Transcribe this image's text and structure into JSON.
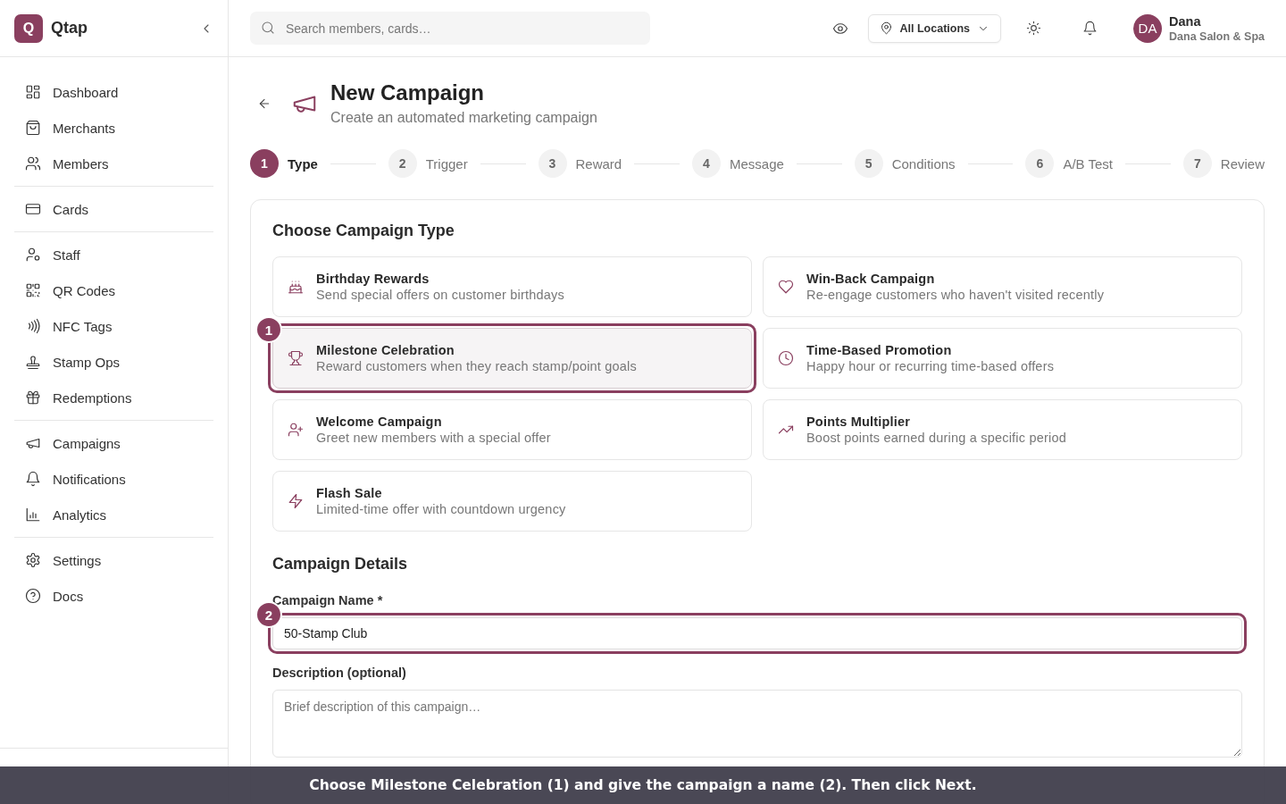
{
  "brand": {
    "logo": "Q",
    "name": "Qtap"
  },
  "nav_groups": [
    [
      "Dashboard",
      "Merchants",
      "Members"
    ],
    [
      "Cards"
    ],
    [
      "Staff",
      "QR Codes",
      "NFC Tags",
      "Stamp Ops",
      "Redemptions"
    ],
    [
      "Campaigns",
      "Notifications",
      "Analytics"
    ],
    [
      "Settings",
      "Docs"
    ]
  ],
  "search": {
    "placeholder": "Search members, cards…"
  },
  "location": "All Locations",
  "user": {
    "initials": "DA",
    "name": "Dana",
    "business": "Dana Salon & Spa"
  },
  "page": {
    "title": "New Campaign",
    "subtitle": "Create an automated marketing campaign"
  },
  "steps": [
    {
      "number": "1",
      "label": "Type",
      "selected": true
    },
    {
      "number": "2",
      "label": "Trigger",
      "selected": false
    },
    {
      "number": "3",
      "label": "Reward",
      "selected": false
    },
    {
      "number": "4",
      "label": "Message",
      "selected": false
    },
    {
      "number": "5",
      "label": "Conditions",
      "selected": false
    },
    {
      "number": "6",
      "label": "A/B Test",
      "selected": false
    },
    {
      "number": "7",
      "label": "Review",
      "selected": false
    }
  ],
  "campaign_types": {
    "heading": "Choose Campaign Type",
    "items": [
      {
        "kind": "birthday",
        "title": "Birthday Rewards",
        "description": "Send special offers on customer birthdays",
        "selected": false
      },
      {
        "kind": "winback",
        "title": "Win-Back Campaign",
        "description": "Re-engage customers who haven't visited recently",
        "selected": false
      },
      {
        "kind": "milestone",
        "title": "Milestone Celebration",
        "description": "Reward customers when they reach stamp/point goals",
        "selected": true,
        "callout": "1"
      },
      {
        "kind": "time",
        "title": "Time-Based Promotion",
        "description": "Happy hour or recurring time-based offers",
        "selected": false
      },
      {
        "kind": "welcome",
        "title": "Welcome Campaign",
        "description": "Greet new members with a special offer",
        "selected": false
      },
      {
        "kind": "multiplier",
        "title": "Points Multiplier",
        "description": "Boost points earned during a specific period",
        "selected": false
      },
      {
        "kind": "flash",
        "title": "Flash Sale",
        "description": "Limited-time offer with countdown urgency",
        "selected": false
      }
    ]
  },
  "details": {
    "heading": "Campaign Details",
    "fields": [
      {
        "kind": "input",
        "label": "Campaign Name *",
        "value": "50-Stamp Club",
        "callout": "2"
      },
      {
        "kind": "textarea",
        "label": "Description (optional)",
        "placeholder": "Brief description of this campaign…"
      }
    ]
  },
  "instruction": "Choose Milestone Celebration (1) and give the campaign a name (2). Then click Next."
}
